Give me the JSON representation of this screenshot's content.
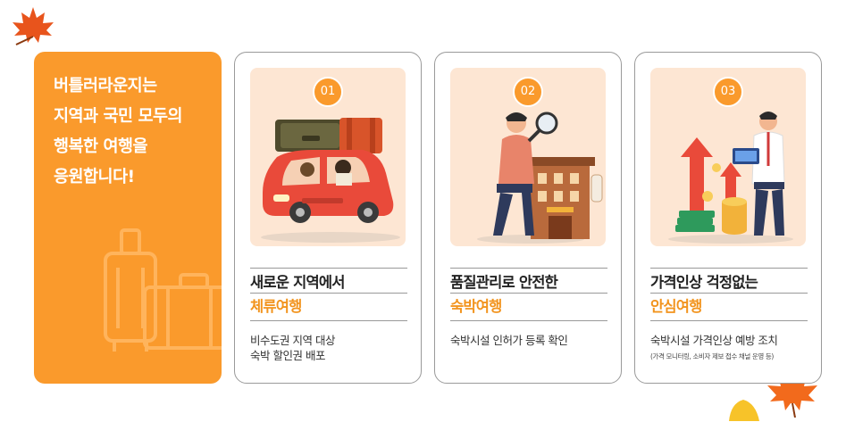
{
  "promo": {
    "lines": [
      "버틀러라운지는",
      "지역과 국민 모두의",
      "행복한 여행을",
      "응원합니다!"
    ]
  },
  "cards": [
    {
      "number": "01",
      "title": "새로운 지역에서",
      "accent": "체류여행",
      "desc": [
        "비수도권 지역 대상",
        "숙박 할인권 배포"
      ],
      "note": ""
    },
    {
      "number": "02",
      "title": "품질관리로 안전한",
      "accent": "숙박여행",
      "desc": [
        "숙박시설 인허가 등록 확인"
      ],
      "note": ""
    },
    {
      "number": "03",
      "title": "가격인상 걱정없는",
      "accent": "안심여행",
      "desc": [
        "숙박시설 가격인상 예방 조치"
      ],
      "note": "(가격 모니터링, 소비자 제보 접수 채널 운영 등)"
    }
  ],
  "colors": {
    "accent": "#fa9a2c",
    "accent_text": "#f2941e",
    "illustration_bg": "#fde6d3",
    "leaf": "#e8541c"
  },
  "icons": [
    "maple-leaf-icon",
    "luggage-icon",
    "car-illustration",
    "hotel-inspection-illustration",
    "price-chart-illustration"
  ]
}
